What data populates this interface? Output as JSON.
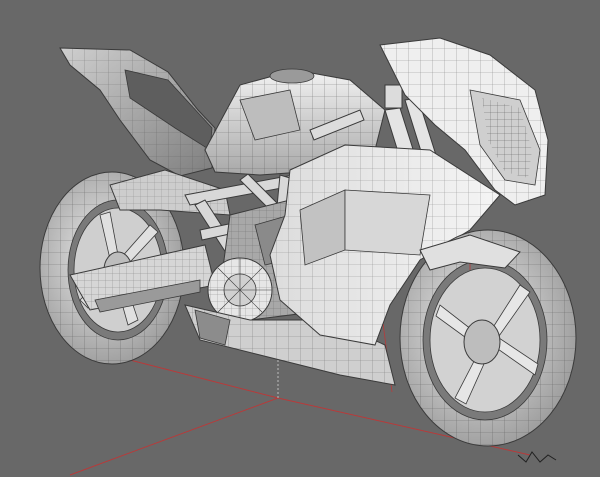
{
  "viewport": {
    "background_color": "#686868",
    "model_fill_light": "#e6e6e6",
    "model_fill_mid": "#bdbdbd",
    "model_fill_dark": "#8c8c8c",
    "wire_color": "#3a3a3a",
    "grid_axis_color": "#b83a3a"
  },
  "model": {
    "subject": "motorcycle",
    "render_style": "wireframe-shaded"
  },
  "axis_gizmo": {
    "icon": "axis-gizmo-icon"
  }
}
